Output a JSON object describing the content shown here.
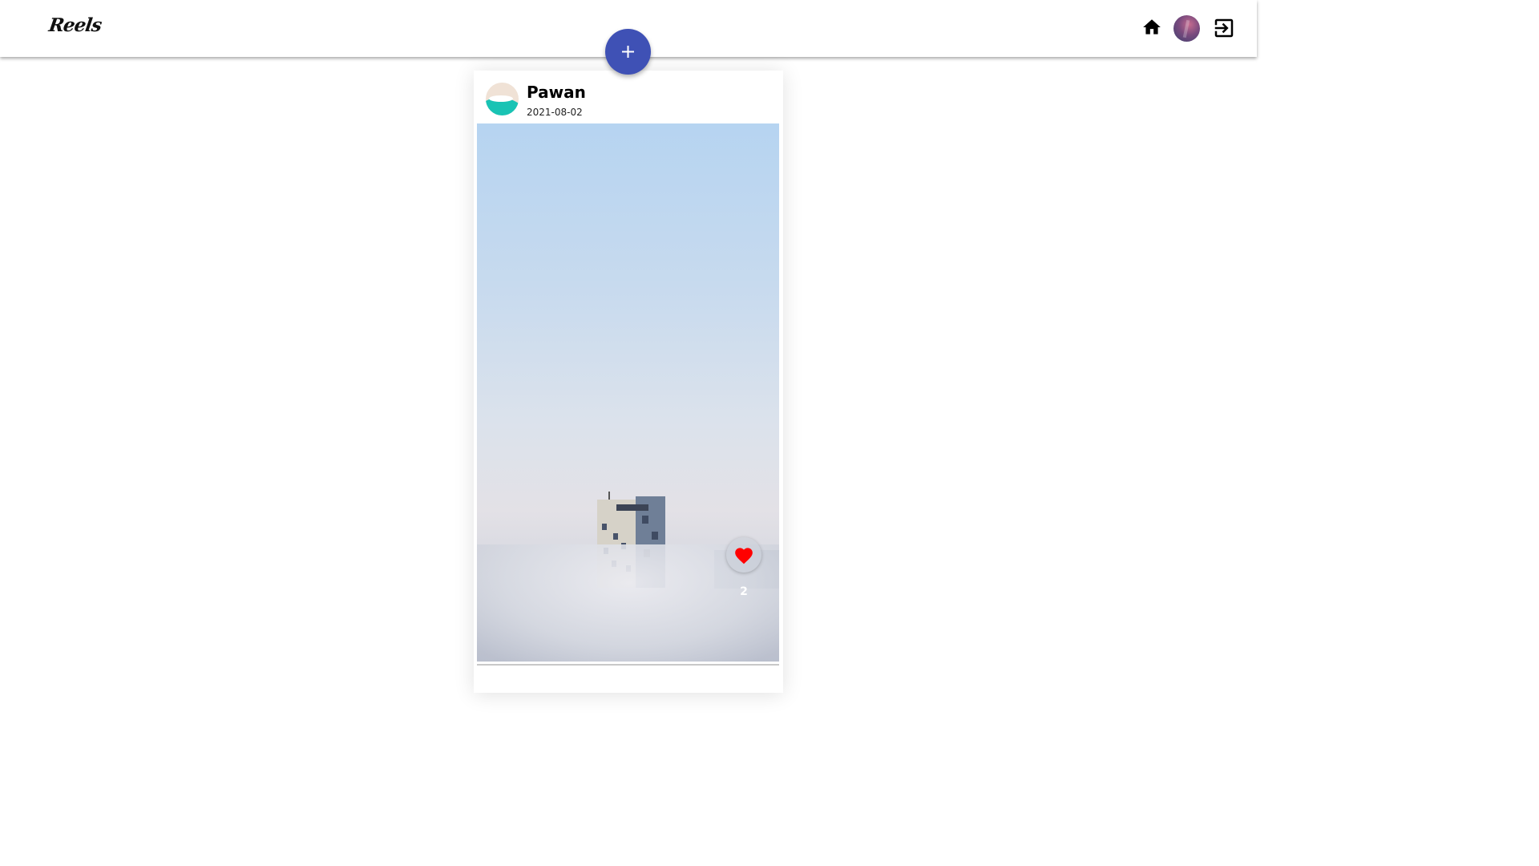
{
  "appbar": {
    "logo_text": "Reels",
    "home_icon": "home-icon",
    "profile_icon": "avatar",
    "logout_icon": "logout-icon"
  },
  "fab": {
    "icon": "plus-icon",
    "color": "#3f51b5"
  },
  "post": {
    "user_name": "Pawan",
    "date": "2021-08-02",
    "likes": "2",
    "like_icon": "heart-icon",
    "like_color": "#ff0000"
  }
}
